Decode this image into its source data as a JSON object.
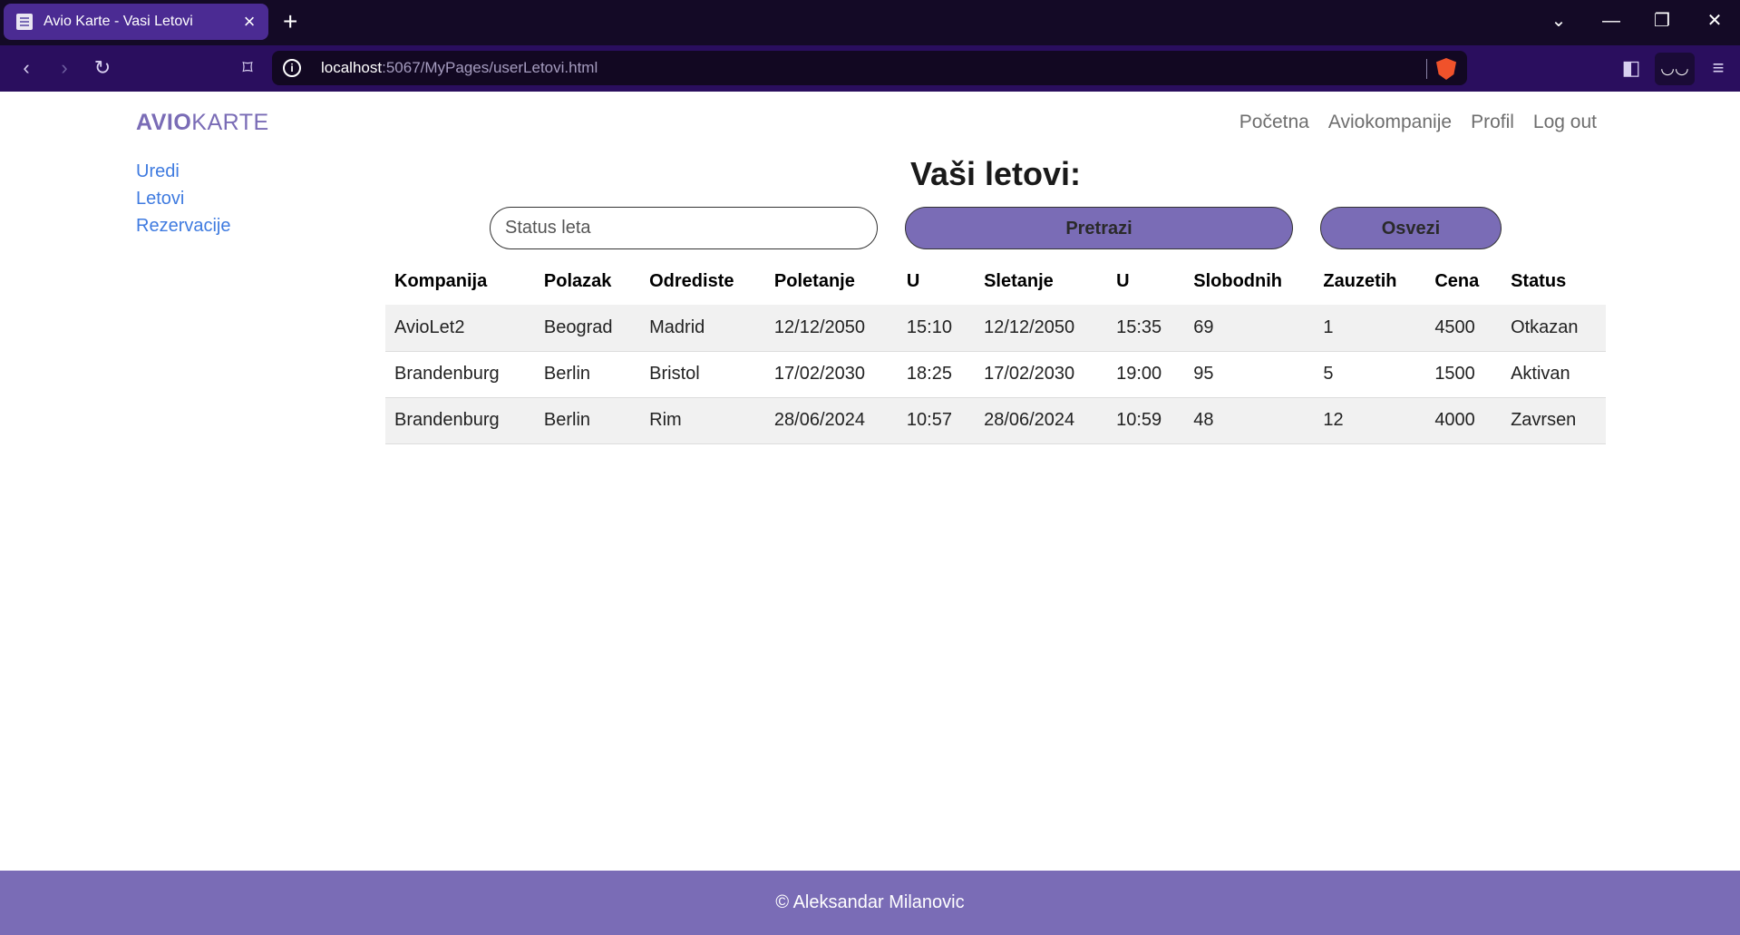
{
  "browser": {
    "tab_title": "Avio Karte - Vasi Letovi",
    "tab_close": "×",
    "new_tab": "+",
    "url_host": "localhost",
    "url_rest": ":5067/MyPages/userLetovi.html"
  },
  "brand": {
    "part1": "AVIO",
    "part2": "KARTE"
  },
  "topnav": [
    "Početna",
    "Aviokompanije",
    "Profil",
    "Log out"
  ],
  "sidenav": [
    "Uredi",
    "Letovi",
    "Rezervacije"
  ],
  "main": {
    "title": "Vaši letovi:",
    "search_placeholder": "Status leta",
    "search_button": "Pretrazi",
    "refresh_button": "Osvezi"
  },
  "table": {
    "headers": [
      "Kompanija",
      "Polazak",
      "Odrediste",
      "Poletanje",
      "U",
      "Sletanje",
      "U",
      "Slobodnih",
      "Zauzetih",
      "Cena",
      "Status"
    ],
    "rows": [
      [
        "AvioLet2",
        "Beograd",
        "Madrid",
        "12/12/2050",
        "15:10",
        "12/12/2050",
        "15:35",
        "69",
        "1",
        "4500",
        "Otkazan"
      ],
      [
        "Brandenburg",
        "Berlin",
        "Bristol",
        "17/02/2030",
        "18:25",
        "17/02/2030",
        "19:00",
        "95",
        "5",
        "1500",
        "Aktivan"
      ],
      [
        "Brandenburg",
        "Berlin",
        "Rim",
        "28/06/2024",
        "10:57",
        "28/06/2024",
        "10:59",
        "48",
        "12",
        "4000",
        "Zavrsen"
      ]
    ]
  },
  "footer": "© Aleksandar Milanovic",
  "colors": {
    "accent": "#7a6cb6",
    "link": "#3f7be0",
    "tabbar": "#140a26",
    "navbar": "#2a0e5e"
  }
}
